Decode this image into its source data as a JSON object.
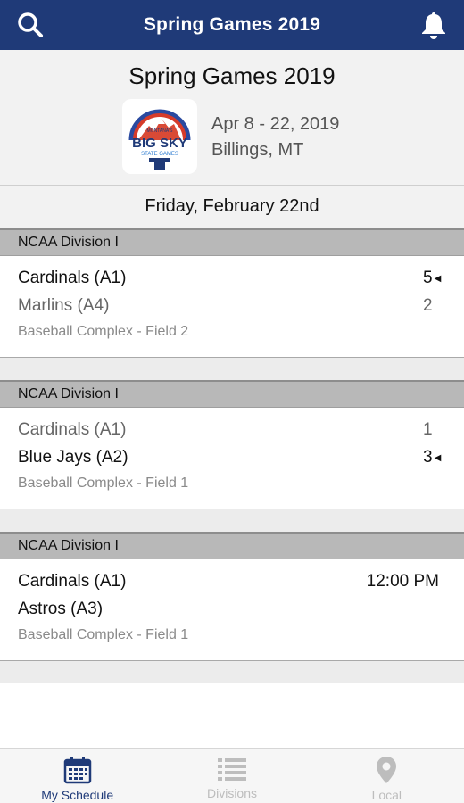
{
  "colors": {
    "header_bg": "#1f3a78",
    "accent": "#1f3a78",
    "inactive_tab": "#bdbdbd",
    "division_bar": "#b8b8b8"
  },
  "header": {
    "title": "Spring Games 2019",
    "left_icon": "search-icon",
    "right_icon": "bell-icon"
  },
  "event": {
    "name": "Spring Games 2019",
    "dates": "Apr 8 - 22, 2019",
    "location": "Billings, MT",
    "logo": {
      "top_text": "MONTANA'S",
      "main_text": "BIG SKY",
      "sub_text": "STATE GAMES"
    }
  },
  "date_header": "Friday, February 22nd",
  "games": [
    {
      "division": "NCAA Division I",
      "teams": [
        {
          "name": "Cardinals (A1)",
          "score": "5",
          "winner": true
        },
        {
          "name": "Marlins (A4)",
          "score": "2",
          "winner": false
        }
      ],
      "venue": "Baseball Complex - Field 2"
    },
    {
      "division": "NCAA Division I",
      "teams": [
        {
          "name": "Cardinals (A1)",
          "score": "1",
          "winner": false
        },
        {
          "name": "Blue Jays (A2)",
          "score": "3",
          "winner": true
        }
      ],
      "venue": "Baseball Complex - Field 1"
    },
    {
      "division": "NCAA Division I",
      "teams": [
        {
          "name": "Cardinals (A1)"
        },
        {
          "name": "Astros (A3)"
        }
      ],
      "time": "12:00 PM",
      "venue": "Baseball Complex - Field 1"
    }
  ],
  "tabs": [
    {
      "label": "My Schedule",
      "icon": "calendar-icon",
      "active": true
    },
    {
      "label": "Divisions",
      "icon": "list-icon",
      "active": false
    },
    {
      "label": "Local",
      "icon": "location-pin-icon",
      "active": false
    }
  ]
}
